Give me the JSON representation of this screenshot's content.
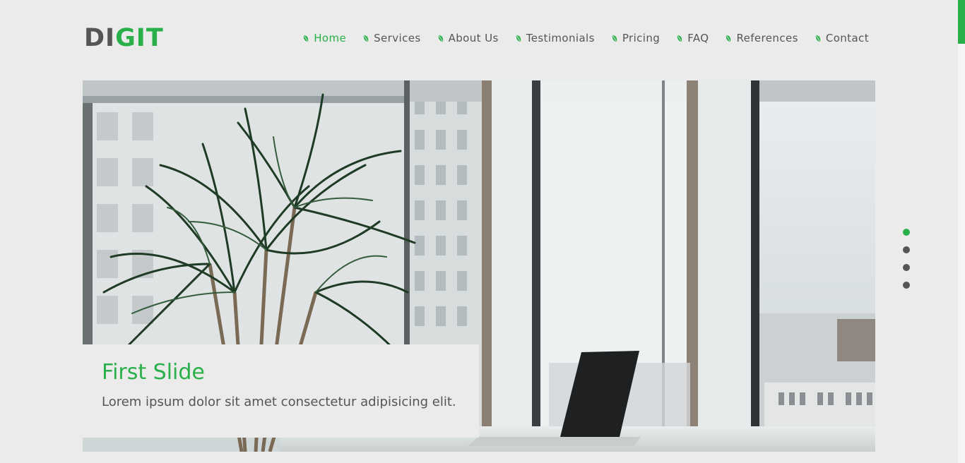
{
  "brand": {
    "logo_part1": "DI",
    "logo_part2": "GIT",
    "color_dark": "#555555",
    "color_accent": "#2ab04a"
  },
  "nav": {
    "items": [
      {
        "label": "Home",
        "active": true,
        "icon": "leaf-icon"
      },
      {
        "label": "Services",
        "active": false,
        "icon": "leaf-icon"
      },
      {
        "label": "About Us",
        "active": false,
        "icon": "leaf-icon"
      },
      {
        "label": "Testimonials",
        "active": false,
        "icon": "leaf-icon"
      },
      {
        "label": "Pricing",
        "active": false,
        "icon": "leaf-icon"
      },
      {
        "label": "FAQ",
        "active": false,
        "icon": "leaf-icon"
      },
      {
        "label": "References",
        "active": false,
        "icon": "leaf-icon"
      },
      {
        "label": "Contact",
        "active": false,
        "icon": "leaf-icon"
      }
    ]
  },
  "hero": {
    "image_subject": "office-with-plant-and-laptop",
    "caption_title": "First Slide",
    "caption_text": "Lorem ipsum dolor sit amet consectetur adipisicing elit."
  },
  "slider": {
    "dot_count": 4,
    "active_index": 0
  }
}
